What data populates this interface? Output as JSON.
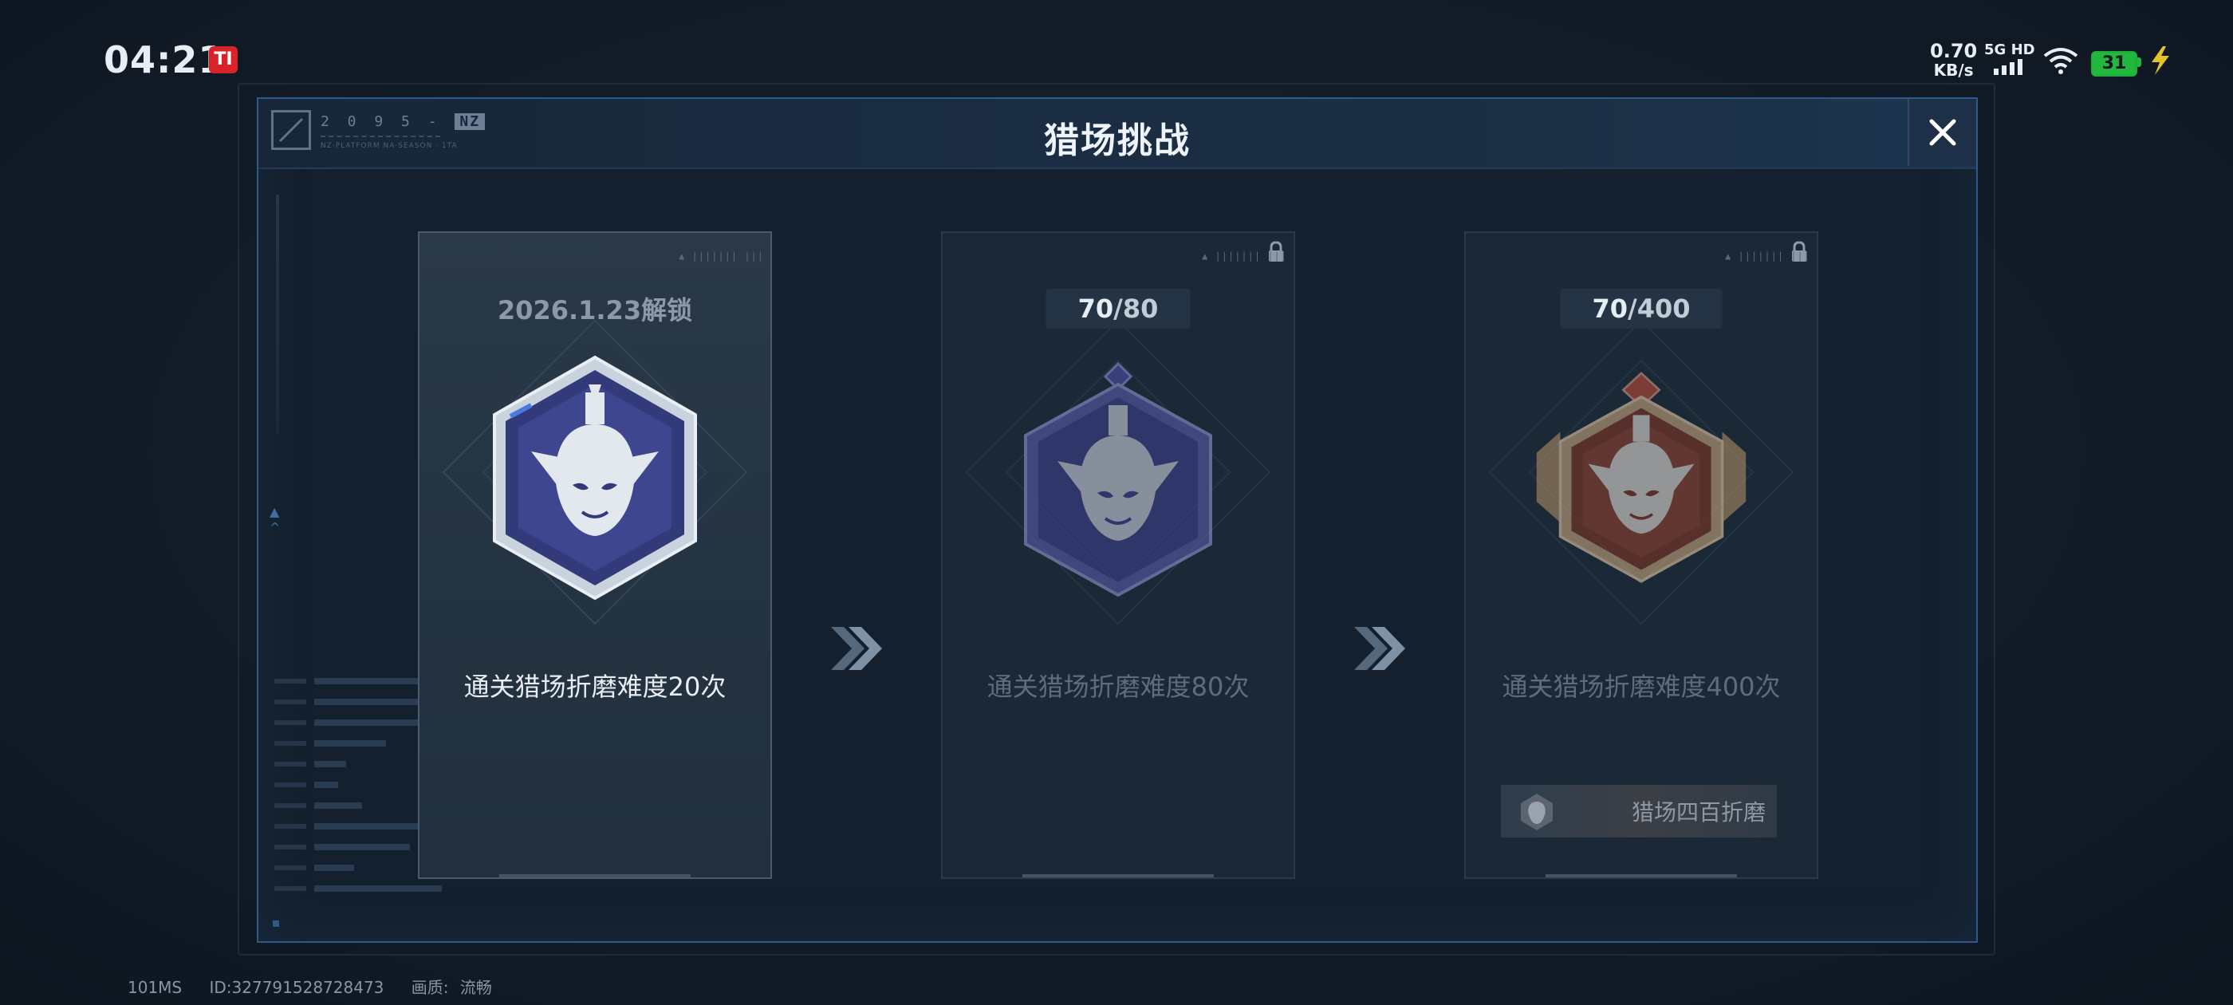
{
  "status_bar": {
    "time": "04:21",
    "app_badge": "TI",
    "net_speed": "0.70",
    "net_speed_unit": "KB/s",
    "net_type": "5G HD",
    "battery": "31"
  },
  "header": {
    "title": "猎场挑战",
    "code_prefix": "2 0 9 5 -",
    "code_tag": "NZ",
    "code_small": "NZ·PLATFORM NA·SEASON · 1TA"
  },
  "cards": [
    {
      "header_text": "2026.1.23解锁",
      "description": "通关猎场折磨难度20次",
      "tag": "▲ ||||||| |||",
      "tier_color": "#3c3f8e"
    },
    {
      "progress_current": "70",
      "progress_total": "/80",
      "description": "通关猎场折磨难度80次",
      "tag": "▲ ||||||| |||",
      "tier_color": "#3c3f8e"
    },
    {
      "progress_current": "70",
      "progress_total": "/400",
      "description": "通关猎场折磨难度400次",
      "tag": "▲ ||||||| |||",
      "reward_label": "猎场四百折磨",
      "tier_color": "#7a3a30"
    }
  ],
  "footer": {
    "latency": "101MS",
    "id": "ID:327791528728473",
    "quality_label": "画质:",
    "quality_value": "流畅"
  }
}
